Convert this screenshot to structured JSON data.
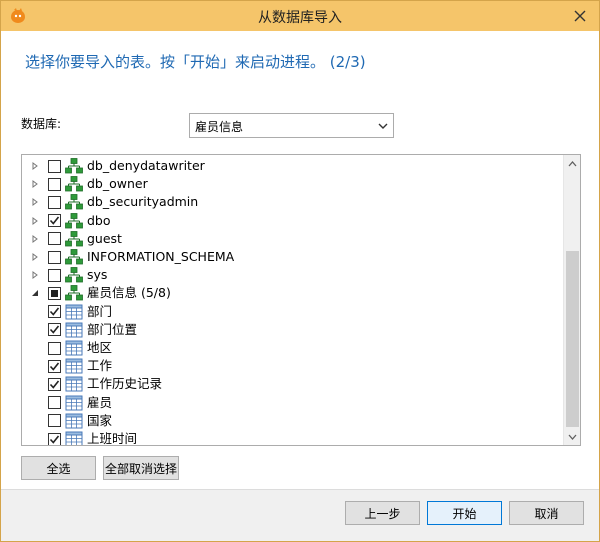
{
  "window": {
    "title": "从数据库导入",
    "icons": {
      "app": "app-icon",
      "close": "close-icon"
    }
  },
  "instruction": "选择你要导入的表。按「开始」来启动进程。 (2/3)",
  "database": {
    "label": "数据库:",
    "selected": "雇员信息"
  },
  "tree": {
    "items": [
      {
        "label": "db_denydatawriter",
        "type": "schema",
        "checked": false
      },
      {
        "label": "db_owner",
        "type": "schema",
        "checked": false
      },
      {
        "label": "db_securityadmin",
        "type": "schema",
        "checked": false
      },
      {
        "label": "dbo",
        "type": "schema",
        "checked": true
      },
      {
        "label": "guest",
        "type": "schema",
        "checked": false
      },
      {
        "label": "INFORMATION_SCHEMA",
        "type": "schema",
        "checked": false
      },
      {
        "label": "sys",
        "type": "schema",
        "checked": false
      },
      {
        "label": "雇员信息 (5/8)",
        "type": "schema",
        "checked": "partial",
        "expanded": true
      },
      {
        "label": "部门",
        "type": "table",
        "checked": true
      },
      {
        "label": "部门位置",
        "type": "table",
        "checked": true
      },
      {
        "label": "地区",
        "type": "table",
        "checked": false
      },
      {
        "label": "工作",
        "type": "table",
        "checked": true
      },
      {
        "label": "工作历史记录",
        "type": "table",
        "checked": true
      },
      {
        "label": "雇员",
        "type": "table",
        "checked": false
      },
      {
        "label": "国家",
        "type": "table",
        "checked": false
      },
      {
        "label": "上班时间",
        "type": "table",
        "checked": true
      }
    ]
  },
  "buttons": {
    "select_all": "全选",
    "deselect_all": "全部取消选择",
    "back": "上一步",
    "start": "开始",
    "cancel": "取消"
  },
  "colors": {
    "titlebar": "#f5c56a",
    "instruction": "#1f69b3",
    "schema_icon": "#2e9a3a",
    "table_icon": "#4a7ab8"
  }
}
